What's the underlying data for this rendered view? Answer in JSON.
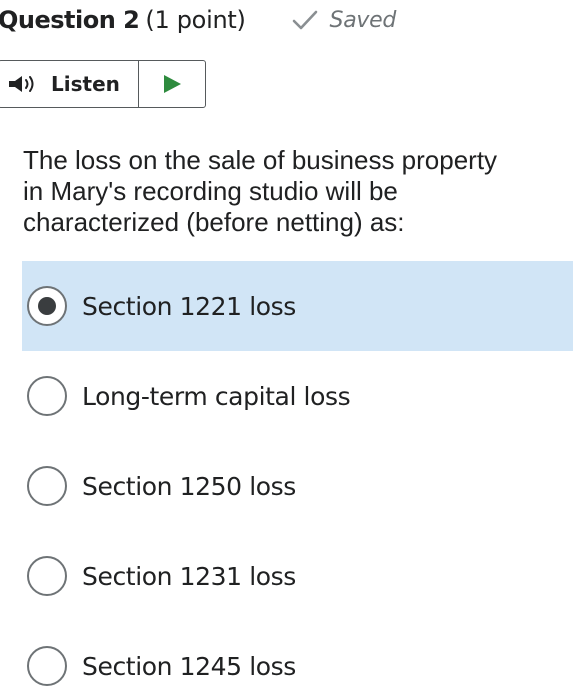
{
  "header": {
    "question_label": "Question 2",
    "points": "(1 point)",
    "saved_icon": "checkmark-icon",
    "saved_text": "Saved"
  },
  "listen": {
    "speaker_icon": "speaker-icon",
    "label": "Listen",
    "play_icon": "play-icon"
  },
  "question": {
    "line1": "The loss on the sale of business property",
    "line2": "in Mary's recording studio will be",
    "line3": "characterized (before netting) as:"
  },
  "options": [
    {
      "label": "Section 1221 loss",
      "selected": true
    },
    {
      "label": "Long-term capital loss",
      "selected": false
    },
    {
      "label": "Section 1250 loss",
      "selected": false
    },
    {
      "label": "Section 1231 loss",
      "selected": false
    },
    {
      "label": "Section 1245 loss",
      "selected": false
    }
  ],
  "colors": {
    "selected_background": "#d1e5f6",
    "play_green": "#2e8b3e",
    "saved_gray": "#6e7376"
  }
}
